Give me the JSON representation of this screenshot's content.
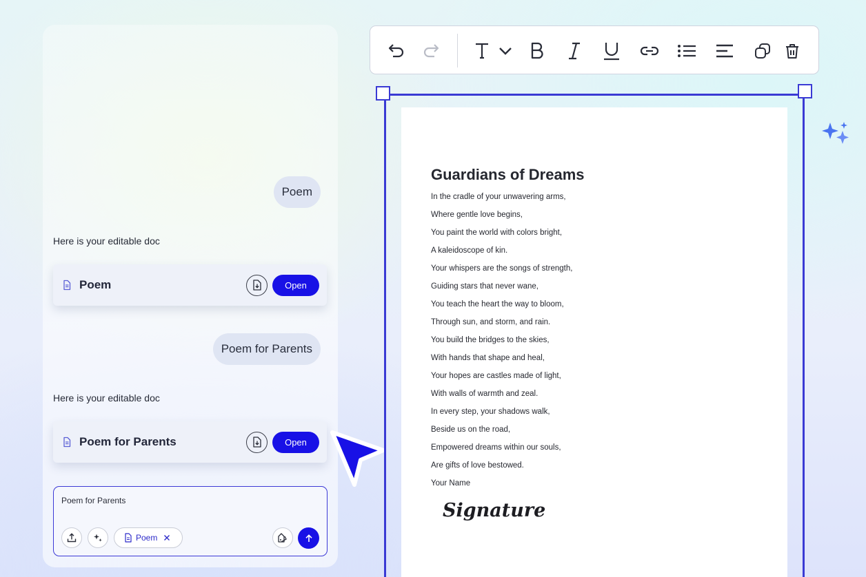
{
  "chat": {
    "messages": [
      {
        "user_text": "Poem",
        "reply_text": "Here is your editable doc",
        "doc_name": "Poem",
        "open_label": "Open"
      },
      {
        "user_text": "Poem for Parents",
        "reply_text": "Here is your editable doc",
        "doc_name": "Poem for Parents",
        "open_label": "Open"
      }
    ],
    "composer": {
      "input_value": "Poem for Parents",
      "attachment_chip": "Poem"
    }
  },
  "toolbar": {
    "tools": [
      "undo-icon",
      "redo-icon",
      "text-style-icon",
      "chevron-down-icon",
      "bold-icon",
      "italic-icon",
      "underline-icon",
      "link-icon",
      "bullet-list-icon",
      "align-left-icon",
      "duplicate-icon",
      "delete-icon"
    ]
  },
  "document": {
    "title": "Guardians of Dreams",
    "lines": [
      "In the cradle of your unwavering arms,",
      "Where gentle love begins,",
      "You paint the world with colors bright,",
      "A kaleidoscope of kin.",
      "Your whispers are the songs of strength,",
      "Guiding stars that never wane,",
      "You teach the heart the way to bloom,",
      "Through sun, and storm, and rain.",
      "You build the bridges to the skies,",
      "With hands that shape and heal,",
      "Your hopes are castles made of light,",
      "With walls of warmth and zeal.",
      "In every step, your shadows walk,",
      "Beside us on the road,",
      "Empowered dreams within our souls,",
      "Are gifts of love bestowed.",
      "Your Name"
    ],
    "signature": "Signature"
  },
  "colors": {
    "accent": "#1811e6",
    "selection_frame": "#3a3ad4"
  }
}
